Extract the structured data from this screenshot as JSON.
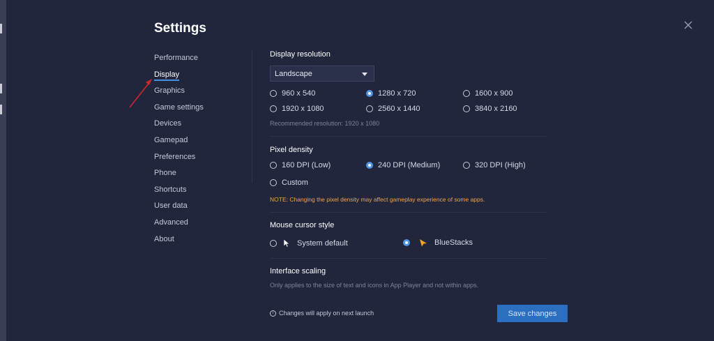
{
  "settings": {
    "title": "Settings",
    "nav": [
      "Performance",
      "Display",
      "Graphics",
      "Game settings",
      "Devices",
      "Gamepad",
      "Preferences",
      "Phone",
      "Shortcuts",
      "User data",
      "Advanced",
      "About"
    ],
    "active_nav": "Display"
  },
  "display_resolution": {
    "title": "Display resolution",
    "orientation": "Landscape",
    "options": [
      "960 x 540",
      "1280 x 720",
      "1600 x 900",
      "1920 x 1080",
      "2560 x 1440",
      "3840 x 2160"
    ],
    "selected": "1280 x 720",
    "recommended": "Recommended resolution: 1920 x 1080"
  },
  "pixel_density": {
    "title": "Pixel density",
    "options": [
      "160 DPI (Low)",
      "240 DPI (Medium)",
      "320 DPI (High)",
      "Custom"
    ],
    "selected": "240 DPI (Medium)",
    "note": "NOTE: Changing the pixel density may affect gameplay experience of some apps."
  },
  "mouse_cursor": {
    "title": "Mouse cursor style",
    "options": [
      "System default",
      "BlueStacks"
    ],
    "selected": "BlueStacks"
  },
  "interface_scaling": {
    "title": "Interface scaling",
    "hint": "Only applies to the size of text and icons in App Player and not within apps."
  },
  "footer": {
    "info": "Changes will apply on next launch",
    "save_label": "Save changes"
  },
  "colors": {
    "background": "#21263d",
    "accent": "#4a90e2",
    "save_button": "#2c6fc0",
    "note": "#f0a44a",
    "annotation_arrow": "#d0262b"
  }
}
